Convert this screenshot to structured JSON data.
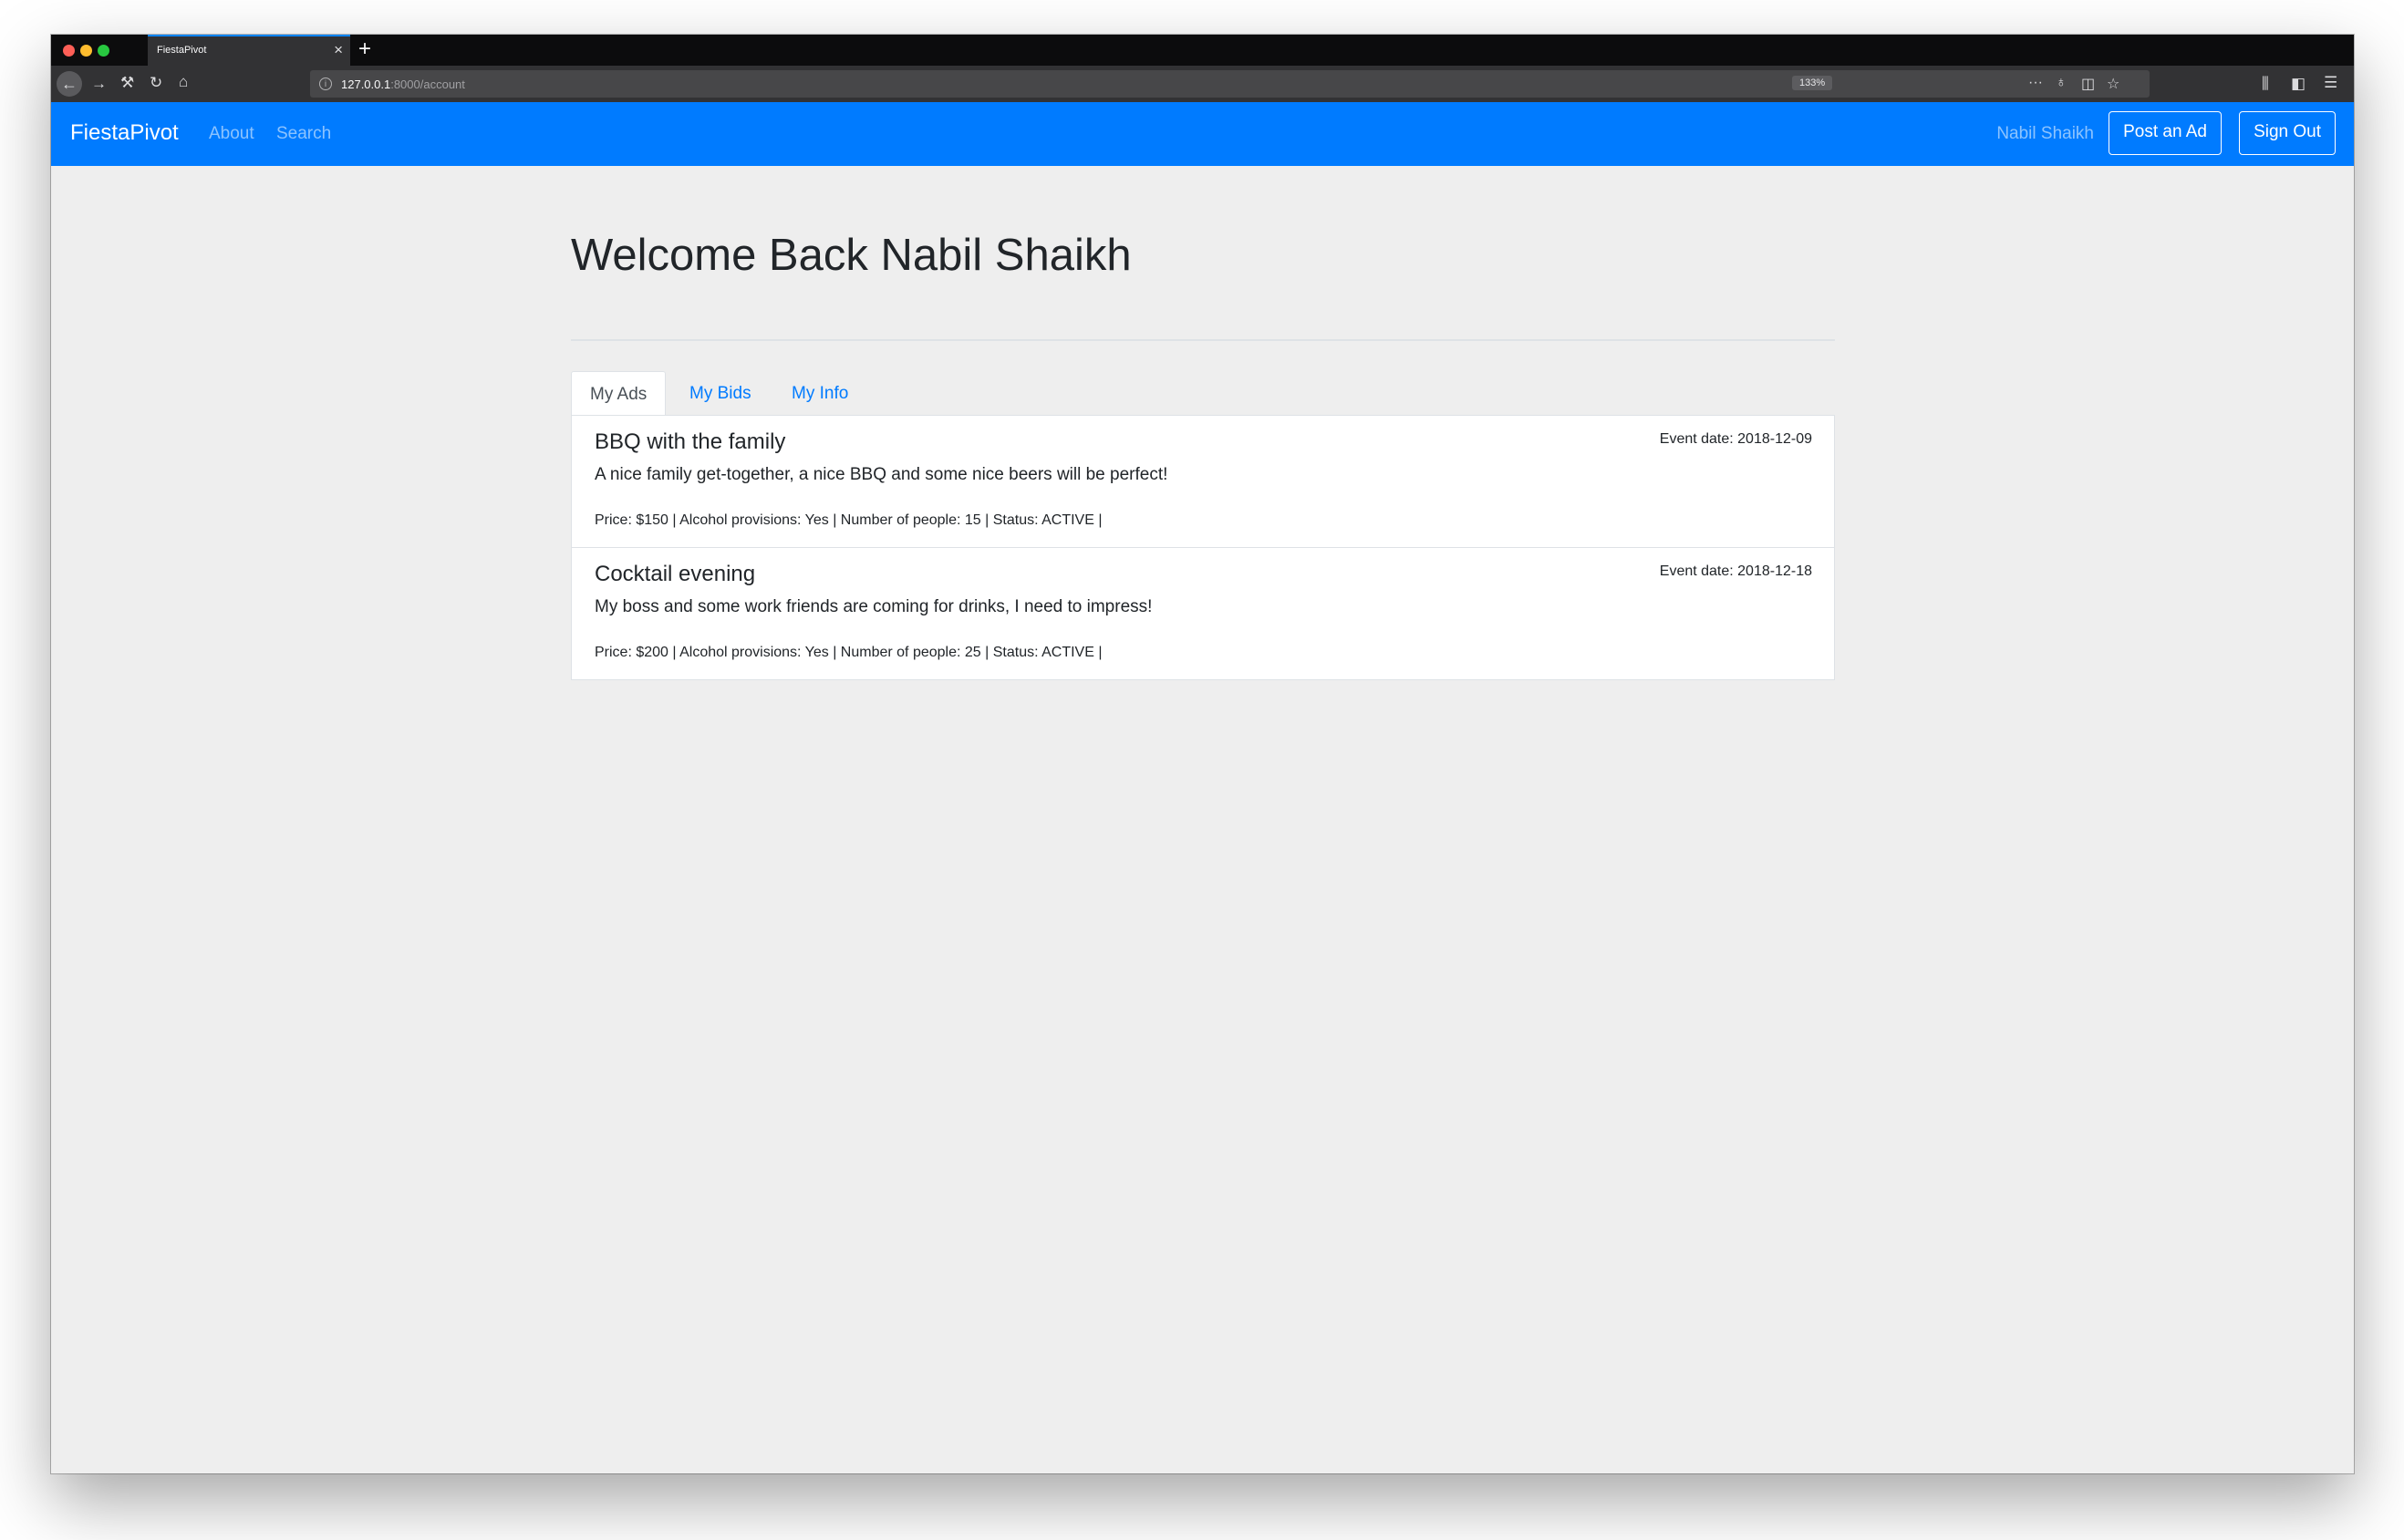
{
  "browser": {
    "tab_title": "FiestaPivot",
    "url_host": "127.0.0.1",
    "url_rest": ":8000/account",
    "zoom": "133%"
  },
  "navbar": {
    "brand": "FiestaPivot",
    "links": [
      "About",
      "Search"
    ],
    "user_name": "Nabil Shaikh",
    "post_ad_label": "Post an Ad",
    "sign_out_label": "Sign Out"
  },
  "main": {
    "title": "Welcome Back Nabil Shaikh",
    "tabs": [
      "My Ads",
      "My Bids",
      "My Info"
    ],
    "active_tab": "My Ads"
  },
  "ads": [
    {
      "title": "BBQ with the family",
      "event_date": "Event date: 2018-12-09",
      "description": "A nice family get-together, a nice BBQ and some nice beers will be perfect!",
      "meta": "Price: $150 | Alcohol provisions: Yes | Number of people: 15 | Status: ACTIVE |"
    },
    {
      "title": "Cocktail evening",
      "event_date": "Event date: 2018-12-18",
      "description": "My boss and some work friends are coming for drinks, I need to impress!",
      "meta": "Price: $200 | Alcohol provisions: Yes | Number of people: 25 | Status: ACTIVE |"
    }
  ],
  "colors": {
    "primary": "#007bff",
    "page_bg": "#eeeeee",
    "text": "#212529"
  },
  "icons": {
    "back": "back-arrow-icon",
    "forward": "forward-arrow-icon",
    "tools": "wrench-icon",
    "reload": "reload-icon",
    "home": "home-icon",
    "more": "ellipsis-icon",
    "bulb": "lightbulb-icon",
    "pocket": "pocket-icon",
    "bookmark": "star-icon",
    "library": "library-icon",
    "sidebar": "sidebar-icon",
    "menu": "hamburger-menu-icon"
  }
}
